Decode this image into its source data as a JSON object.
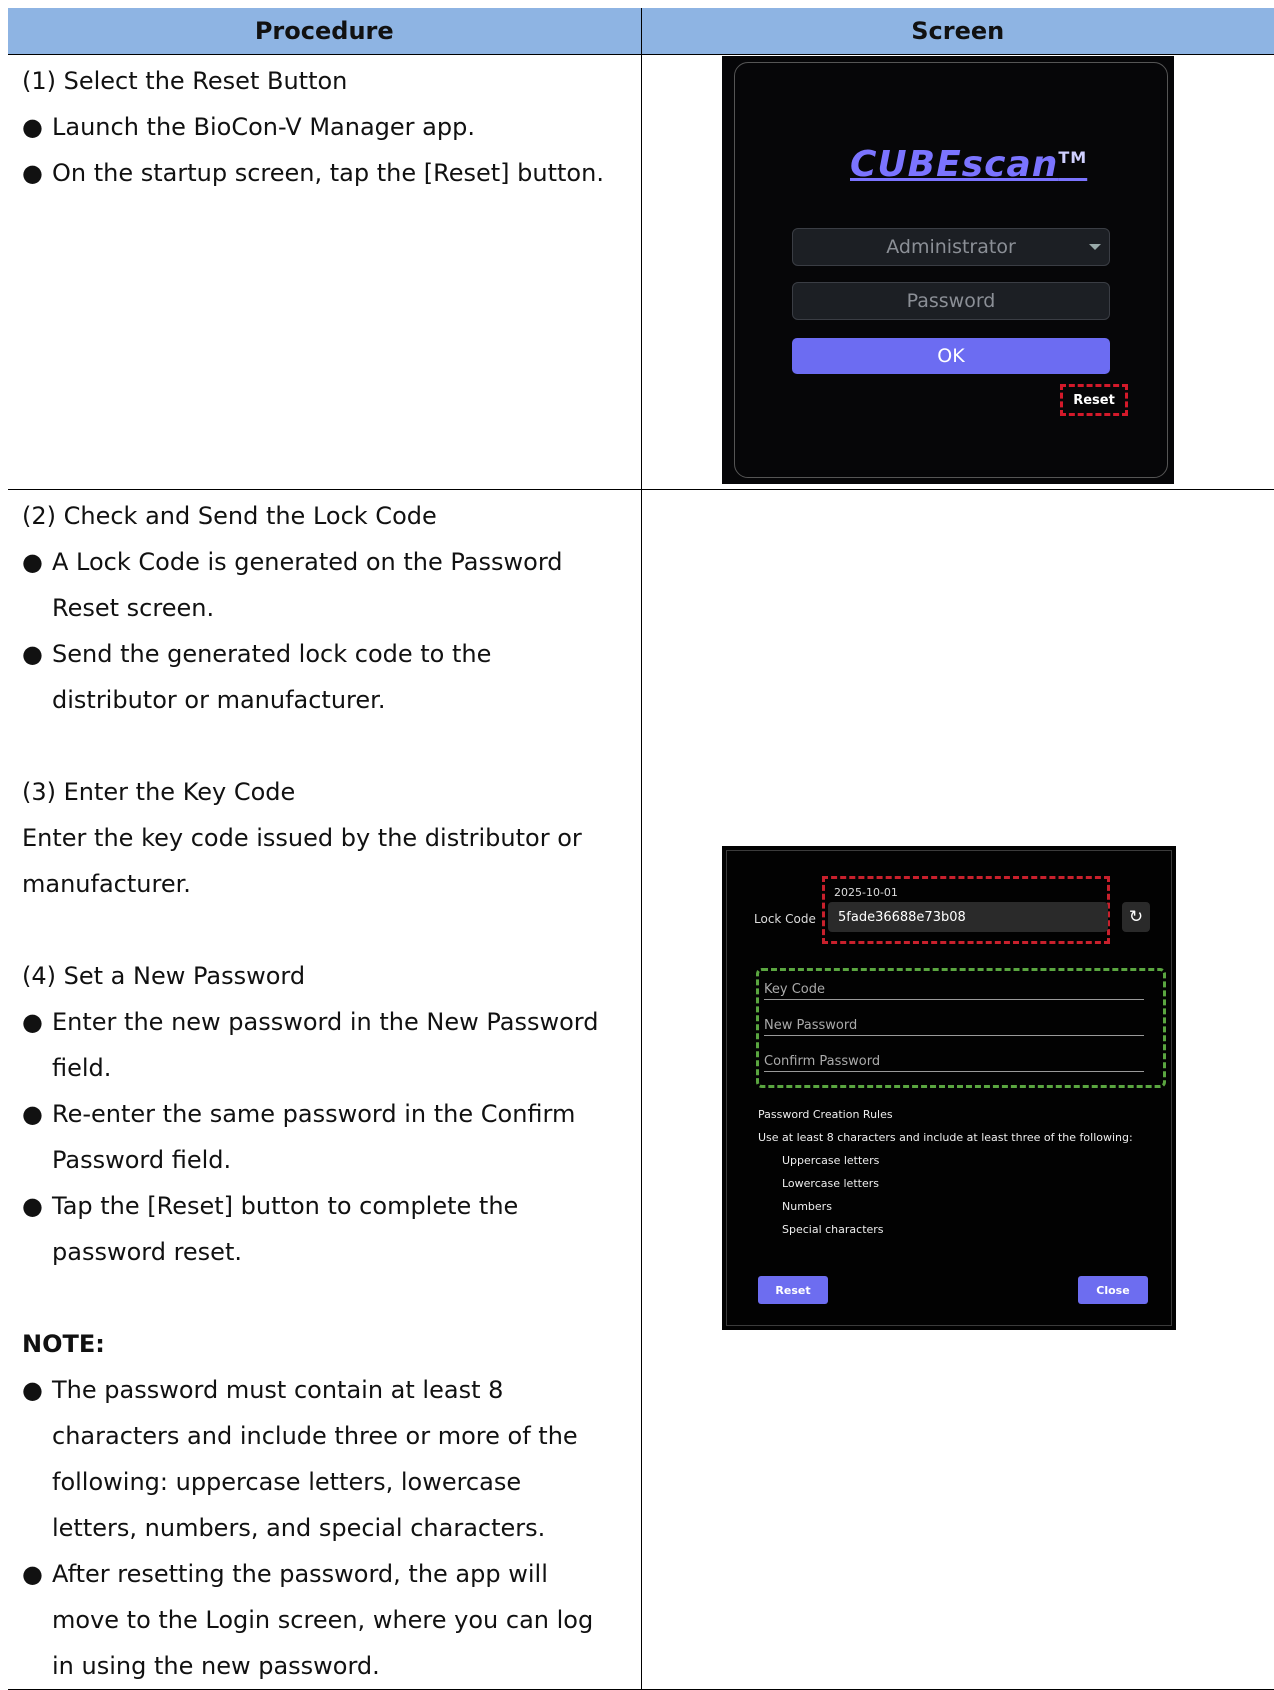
{
  "table": {
    "header_procedure": "Procedure",
    "header_screen": "Screen"
  },
  "step1": {
    "title": "(1) Select the Reset Button",
    "bullets": [
      "Launch the BioCon-V Manager app.",
      "On the startup screen, tap the [Reset] button."
    ]
  },
  "step2": {
    "title": "(2) Check and Send the Lock Code",
    "bullets": [
      "A Lock Code is generated on the Password Reset screen.",
      "Send the generated lock code to the distributor or manufacturer."
    ]
  },
  "step3": {
    "title": "(3) Enter the Key Code",
    "text": "Enter the key code issued by the distributor or manufacturer."
  },
  "step4": {
    "title": "(4) Set a New Password",
    "bullets": [
      "Enter the new password in the New Password field.",
      "Re-enter the same password in the Confirm Password field.",
      "Tap the [Reset] button to complete the password reset."
    ]
  },
  "note": {
    "title": "NOTE:",
    "bullets": [
      "The password must contain at least 8 characters and include three or more of the following: uppercase letters, lowercase letters, numbers, and special characters.",
      "After resetting the password, the app will move to the Login screen, where you can log in using the new password."
    ]
  },
  "login_screen": {
    "logo": "CUBEscan",
    "tm": "TM",
    "role_select": "Administrator",
    "password_placeholder": "Password",
    "ok_label": "OK",
    "reset_label": "Reset"
  },
  "reset_screen": {
    "date": "2025-10-01",
    "lock_code_label": "Lock Code",
    "lock_code_value": "5fade36688e73b08",
    "key_code_placeholder": "Key Code",
    "new_password_placeholder": "New Password",
    "confirm_password_placeholder": "Confirm Password",
    "rules_title": "Password Creation Rules",
    "rules_intro": "Use at least 8 characters and include at least three of the following:",
    "rules": [
      "Uppercase letters",
      "Lowercase letters",
      "Numbers",
      "Special characters"
    ],
    "reset_label": "Reset",
    "close_label": "Close"
  }
}
